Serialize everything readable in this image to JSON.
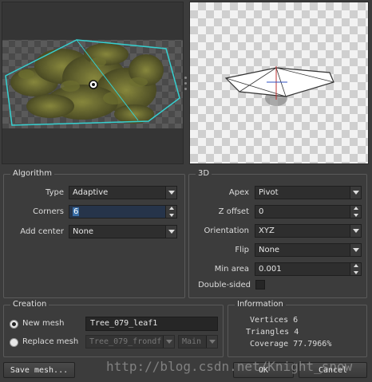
{
  "algorithm": {
    "title": "Algorithm",
    "type_label": "Type",
    "type_value": "Adaptive",
    "corners_label": "Corners",
    "corners_value": "6",
    "add_center_label": "Add center",
    "add_center_value": "None"
  },
  "three_d": {
    "title": "3D",
    "apex_label": "Apex",
    "apex_value": "Pivot",
    "z_offset_label": "Z offset",
    "z_offset_value": "0",
    "orientation_label": "Orientation",
    "orientation_value": "XYZ",
    "flip_label": "Flip",
    "flip_value": "None",
    "min_area_label": "Min area",
    "min_area_value": "0.001",
    "double_sided_label": "Double-sided",
    "double_sided_checked": false
  },
  "creation": {
    "title": "Creation",
    "new_mesh_label": "New mesh",
    "new_mesh_value": "Tree_079_leaf1",
    "replace_mesh_label": "Replace mesh",
    "replace_mesh_value": "Tree_079_frondf",
    "replace_submesh_value": "Main",
    "selected": "new_mesh"
  },
  "information": {
    "title": "Information",
    "vertices": "Vertices 6",
    "triangles": "Triangles 4",
    "coverage": "Coverage 77.7966%"
  },
  "buttons": {
    "save_mesh": "Save mesh...",
    "ok": "OK",
    "cancel": "Cancel"
  },
  "watermark": "http://blog.csdn.net/Knight_snow",
  "colors": {
    "outline": "#36d0d0",
    "background": "#3c3c3c",
    "selection": "#3a6fa8"
  }
}
